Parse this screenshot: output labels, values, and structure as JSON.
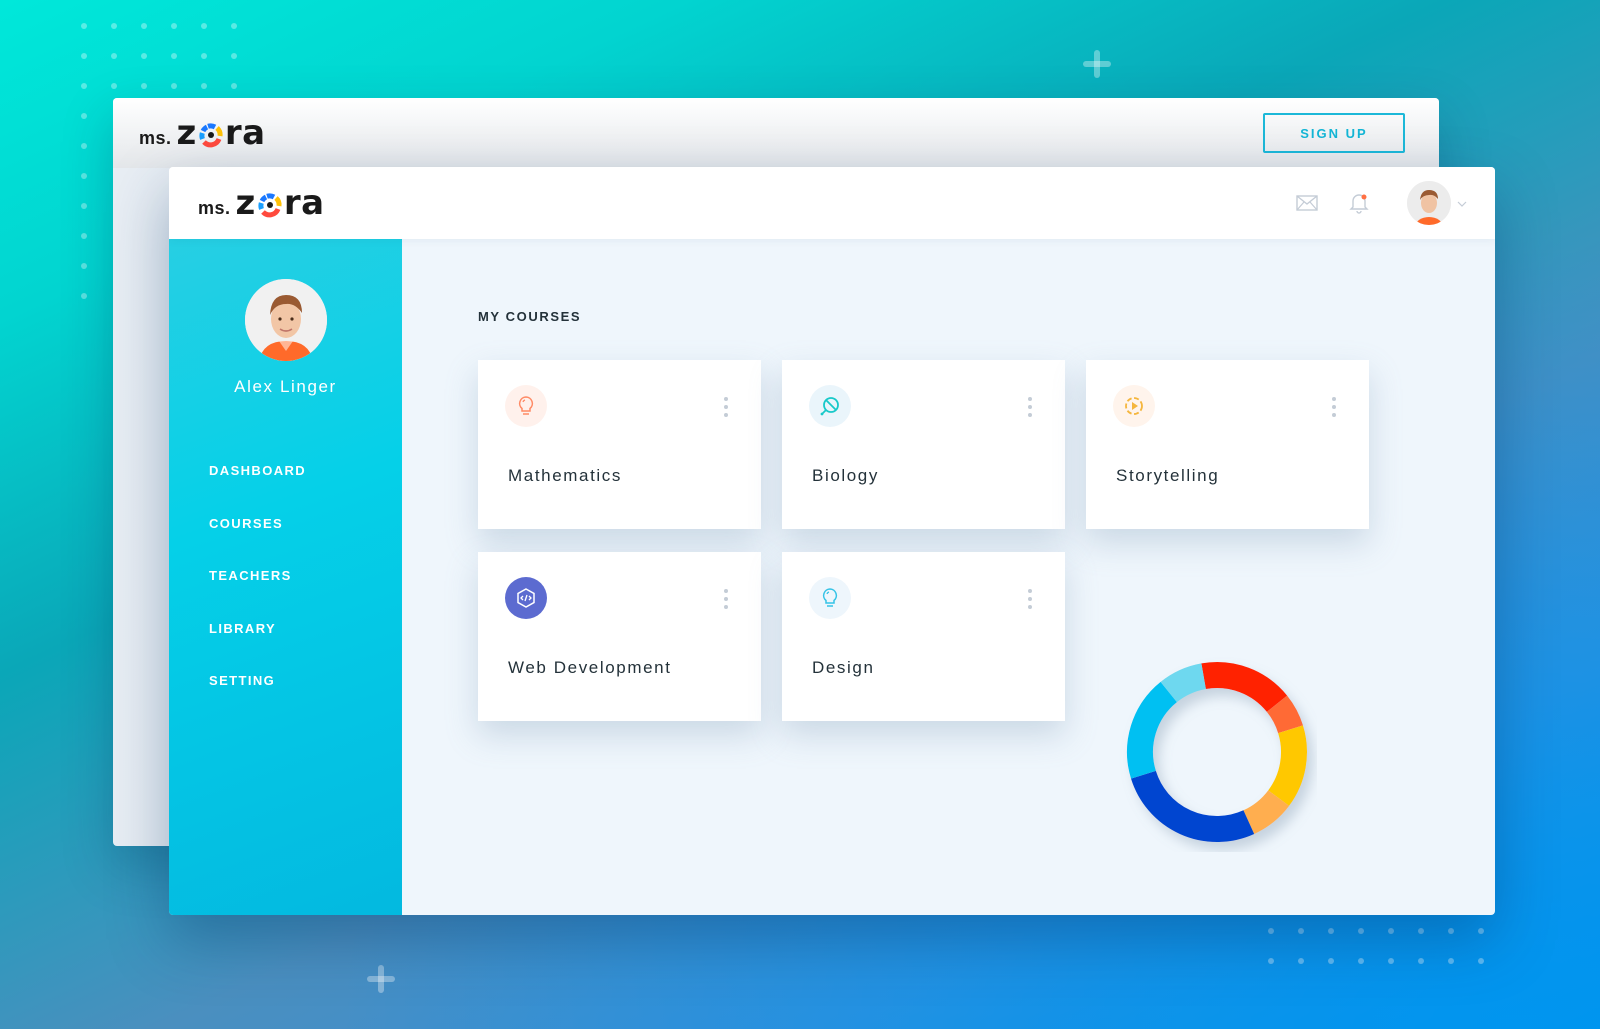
{
  "back_window": {
    "logo": {
      "prefix": "ms.",
      "brand_first": "z",
      "brand_rest": "ra"
    },
    "signup_label": "SIGN UP"
  },
  "front_window": {
    "logo": {
      "prefix": "ms.",
      "brand_first": "z",
      "brand_rest": "ra"
    },
    "header": {
      "icons": [
        "mail-icon",
        "bell-icon",
        "user-avatar",
        "chevron-down-icon"
      ],
      "notification_dot_color": "#ff7043"
    },
    "profile": {
      "name": "Alex Linger"
    },
    "nav": [
      {
        "label": "DASHBOARD"
      },
      {
        "label": "COURSES"
      },
      {
        "label": "TEACHERS"
      },
      {
        "label": "LIBRARY"
      },
      {
        "label": "SETTING"
      }
    ],
    "section_title": "MY COURSES",
    "courses": [
      {
        "title": "Mathematics",
        "icon": "lightbulb-icon",
        "icon_color": "#ff8a65",
        "icon_bg": "#fff1ec"
      },
      {
        "title": "Biology",
        "icon": "leaf-icon",
        "icon_color": "#18c9c9",
        "icon_bg": "#eaf5fb"
      },
      {
        "title": "Storytelling",
        "icon": "play-circle-icon",
        "icon_color": "#f5b63d",
        "icon_bg": "#fff4ec"
      },
      {
        "title": "Web Development",
        "icon": "code-icon",
        "icon_color": "#ffffff",
        "icon_bg": "#5c6bd0"
      },
      {
        "title": "Design",
        "icon": "lightbulb-icon",
        "icon_color": "#35c3e6",
        "icon_bg": "#eef6fc"
      }
    ],
    "donut": {
      "segments": [
        {
          "color": "#ff2200",
          "share": 0.17
        },
        {
          "color": "#ff6b35",
          "share": 0.06
        },
        {
          "color": "#ffc800",
          "share": 0.15
        },
        {
          "color": "#ffae4f",
          "share": 0.08
        },
        {
          "color": "#0044d0",
          "share": 0.27
        },
        {
          "color": "#00c0f2",
          "share": 0.19
        },
        {
          "color": "#6ed8ef",
          "share": 0.08
        }
      ]
    }
  }
}
